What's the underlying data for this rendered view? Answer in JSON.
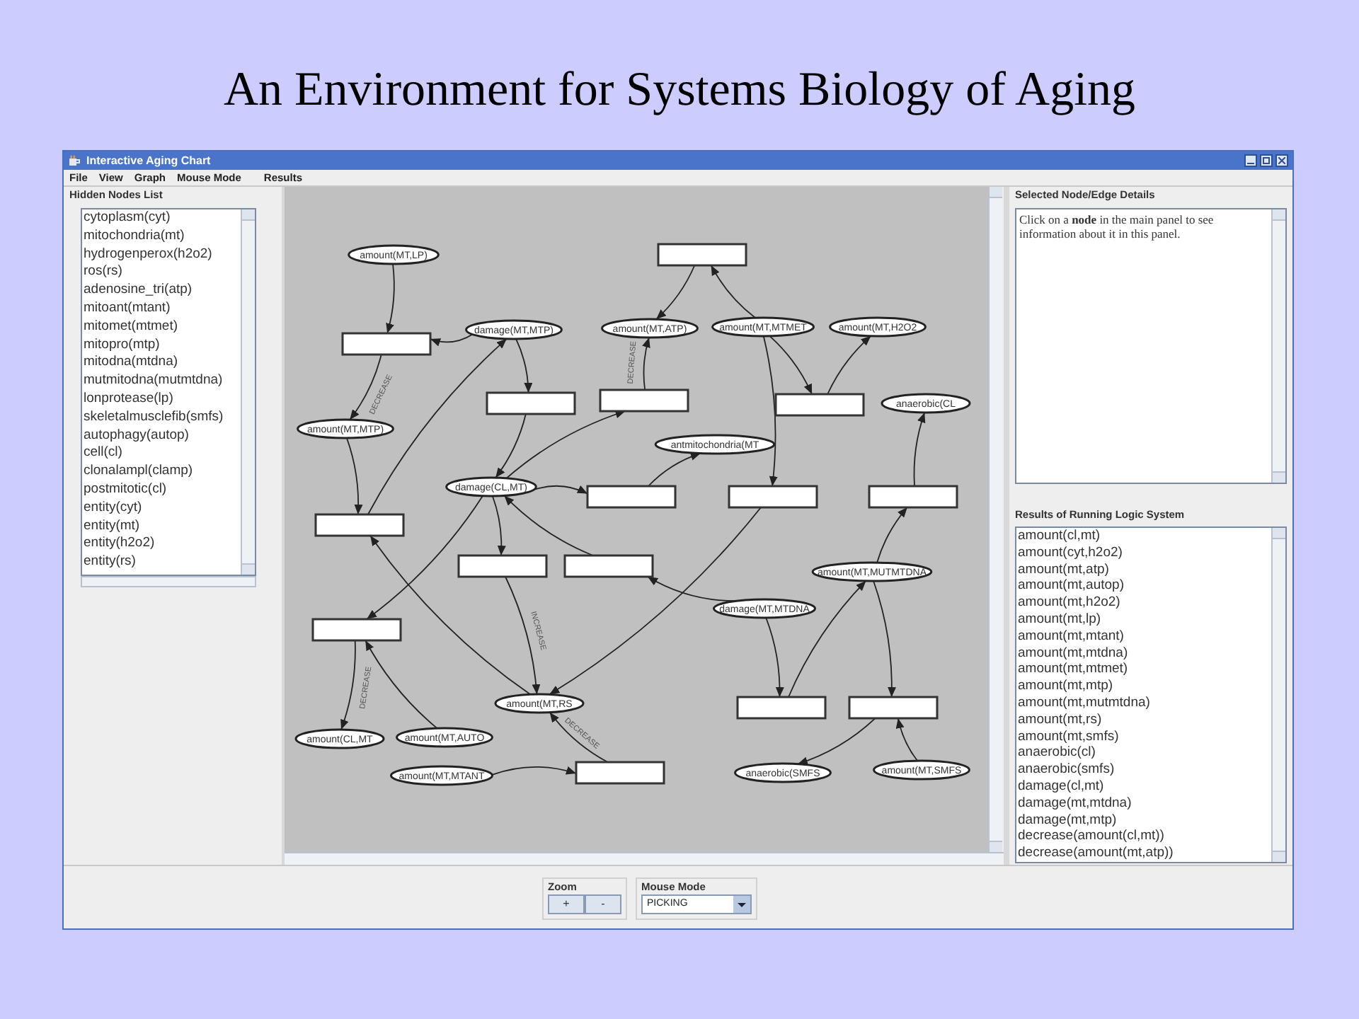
{
  "slide_title": "An Environment for Systems Biology of Aging",
  "window": {
    "title": "Interactive Aging Chart"
  },
  "menu": [
    "File",
    "View",
    "Graph",
    "Mouse Mode",
    "Results"
  ],
  "hidden_nodes": {
    "title": "Hidden Nodes List",
    "items": [
      "cytoplasm(cyt)",
      "mitochondria(mt)",
      "hydrogenperox(h2o2)",
      "ros(rs)",
      "adenosine_tri(atp)",
      "mitoant(mtant)",
      "mitomet(mtmet)",
      "mitopro(mtp)",
      "mitodna(mtdna)",
      "mutmitodna(mutmtdna)",
      "lonprotease(lp)",
      "skeletalmusclefib(smfs)",
      "autophagy(autop)",
      "cell(cl)",
      "clonalampl(clamp)",
      "postmitotic(cl)",
      "entity(cyt)",
      "entity(mt)",
      "entity(h2o2)",
      "entity(rs)"
    ]
  },
  "graph": {
    "nodes": [
      {
        "kind": "ellipse",
        "label": "amount(MT,LP)"
      },
      {
        "kind": "ellipse",
        "label": "damage(MT,MTP)"
      },
      {
        "kind": "ellipse",
        "label": "amount(MT,ATP)"
      },
      {
        "kind": "ellipse",
        "label": "amount(MT,MTMET"
      },
      {
        "kind": "ellipse",
        "label": "amount(MT,H2O2"
      },
      {
        "kind": "ellipse",
        "label": "anaerobic(CL"
      },
      {
        "kind": "ellipse",
        "label": "amount(MT,MTP)"
      },
      {
        "kind": "ellipse",
        "label": "antmitochondria(MT"
      },
      {
        "kind": "ellipse",
        "label": "damage(CL,MT)"
      },
      {
        "kind": "ellipse",
        "label": "amount(MT,MUTMTDNA"
      },
      {
        "kind": "ellipse",
        "label": "damage(MT,MTDNA"
      },
      {
        "kind": "ellipse",
        "label": "amount(MT,RS"
      },
      {
        "kind": "ellipse",
        "label": "amount(CL,MT"
      },
      {
        "kind": "ellipse",
        "label": "amount(MT,AUTO"
      },
      {
        "kind": "ellipse",
        "label": "amount(MT,MTANT"
      },
      {
        "kind": "ellipse",
        "label": "anaerobic(SMFS"
      },
      {
        "kind": "ellipse",
        "label": "amount(MT,SMFS"
      },
      {
        "kind": "box"
      },
      {
        "kind": "box"
      },
      {
        "kind": "box"
      },
      {
        "kind": "box"
      },
      {
        "kind": "box"
      },
      {
        "kind": "box"
      },
      {
        "kind": "box"
      },
      {
        "kind": "box"
      },
      {
        "kind": "box"
      },
      {
        "kind": "box"
      },
      {
        "kind": "box"
      },
      {
        "kind": "box"
      },
      {
        "kind": "box"
      },
      {
        "kind": "box"
      },
      {
        "kind": "box"
      }
    ],
    "edge_labels": [
      "DECREASE",
      "DECREASE",
      "INCREASE",
      "DECREASE",
      "DECREASE"
    ]
  },
  "details": {
    "title": "Selected Node/Edge Details",
    "text": "Click on a **node** in the main panel to see information about it in this panel."
  },
  "results": {
    "title": "Results of Running Logic System",
    "items": [
      "amount(cl,mt)",
      "amount(cyt,h2o2)",
      "amount(mt,atp)",
      "amount(mt,autop)",
      "amount(mt,h2o2)",
      "amount(mt,lp)",
      "amount(mt,mtant)",
      "amount(mt,mtdna)",
      "amount(mt,mtmet)",
      "amount(mt,mtp)",
      "amount(mt,mutmtdna)",
      "amount(mt,rs)",
      "amount(mt,smfs)",
      "anaerobic(cl)",
      "anaerobic(smfs)",
      "damage(cl,mt)",
      "damage(mt,mtdna)",
      "damage(mt,mtp)",
      "decrease(amount(cl,mt))",
      "decrease(amount(mt,atp))"
    ]
  },
  "zoom": {
    "title": "Zoom",
    "buttons": [
      "+",
      "-"
    ]
  },
  "mouse_mode": {
    "title": "Mouse Mode",
    "value": "PICKING"
  }
}
